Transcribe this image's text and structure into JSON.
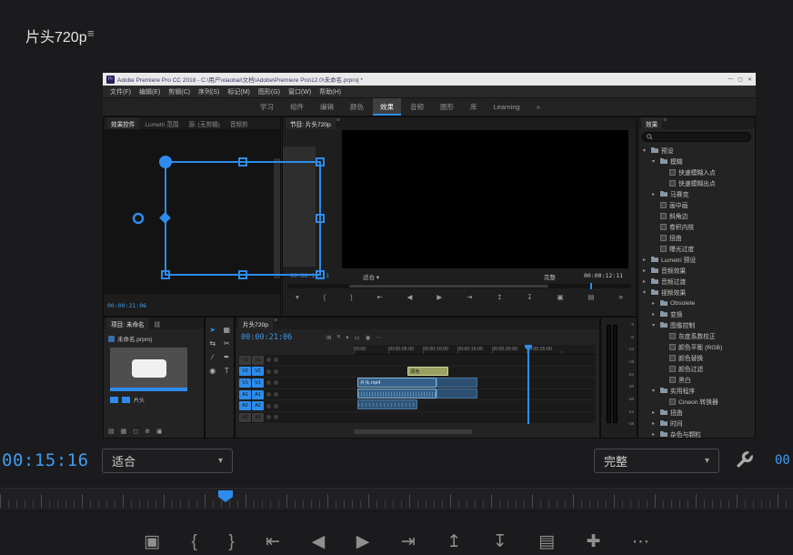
{
  "monitor": {
    "title": "片头720p",
    "panel_menu": "≡",
    "timecode": "00:15:16",
    "fit": "适合",
    "quality": "完整",
    "duration_partial": "00",
    "transport_icons": [
      "▣",
      "{",
      "}",
      "⇤",
      "◀",
      "▶",
      "⇥",
      "↥",
      "↧",
      "▤",
      "✚",
      "⋯"
    ]
  },
  "premiere": {
    "window_title": "Adobe Premiere Pro CC 2018 - C:\\用户\\xiaobai\\文档\\Adobe\\Premiere Pro\\12.0\\未命名.prproj *",
    "logo": "Pr",
    "window_buttons": [
      "—",
      "▢",
      "✕"
    ],
    "menus": [
      "文件(F)",
      "编辑(E)",
      "剪辑(C)",
      "序列(S)",
      "标记(M)",
      "图形(G)",
      "窗口(W)",
      "帮助(H)"
    ],
    "workspaces": [
      {
        "label": "学习"
      },
      {
        "label": "组件"
      },
      {
        "label": "编辑"
      },
      {
        "label": "颜色"
      },
      {
        "label": "效果",
        "cls": "active"
      },
      {
        "label": "音频"
      },
      {
        "label": "图形"
      },
      {
        "label": "库"
      },
      {
        "label": "Learning"
      },
      {
        "label": "»"
      }
    ],
    "effect_controls": {
      "tabs": [
        {
          "label": "效果控件",
          "cls": "active"
        },
        {
          "label": "Lumetri 范围"
        },
        {
          "label": "源: (无剪辑)"
        },
        {
          "label": "音频剪"
        }
      ],
      "timecode": "00:00:21:06"
    },
    "program": {
      "tab": "节目: 片头720p",
      "timecode": "00:00:12:11",
      "fit": "适合 ▾",
      "quality": "完整",
      "duration": "00:00:12:11",
      "transport_icons": [
        "▾",
        "{",
        "}",
        "⇤",
        "◀",
        "▶",
        "⇥",
        "↥",
        "↧",
        "▣",
        "▤",
        "≡"
      ]
    },
    "project": {
      "tabs": [
        {
          "label": "项目: 未命名",
          "cls": "active"
        },
        {
          "label": "媒"
        }
      ],
      "file": "未命名.prproj",
      "item_label": "片头",
      "footer_icons": [
        "▤",
        "▦",
        "◻",
        "⊕",
        "▣"
      ]
    },
    "tools": [
      {
        "g": "➤",
        "cls": "active"
      },
      {
        "g": "▦"
      },
      {
        "g": "⇆"
      },
      {
        "g": "✂"
      },
      {
        "g": "∕"
      },
      {
        "g": "✒"
      },
      {
        "g": "◉"
      },
      {
        "g": "T"
      }
    ],
    "timeline": {
      "tab": "片头720p",
      "timecode": "00:00:21:06",
      "toolbar_icons": [
        "⊞",
        "≡",
        "▾",
        "▭",
        "◉",
        "⋯"
      ],
      "ruler": [
        "00:00",
        "00:00:05:00",
        "00:00:10:00",
        "00:00:15:00",
        "00:00:20:00",
        "00:00:25:00"
      ],
      "tracks": [
        {
          "name": "V3",
          "cls": "dim"
        },
        {
          "name": "V2",
          "cls": "blue"
        },
        {
          "name": "V1",
          "cls": "blue"
        },
        {
          "name": "A1",
          "cls": "blue"
        },
        {
          "name": "A2",
          "cls": "blue"
        },
        {
          "name": "A3",
          "cls": "dim"
        }
      ],
      "clips": {
        "graphic": "调色",
        "video": "片头.mp4"
      }
    },
    "meters": [
      "0",
      "-6",
      "-12",
      "-18",
      "-24",
      "-30",
      "-36",
      "-42",
      "-48"
    ],
    "effects_panel": {
      "tab": "效果",
      "tree": [
        {
          "arrow": "▾",
          "label": "预设",
          "cls": "l0"
        },
        {
          "arrow": "▾",
          "label": "模糊",
          "cls": "l1"
        },
        {
          "arrow": "",
          "label": "快速模糊入点",
          "cls": "l2 fx"
        },
        {
          "arrow": "",
          "label": "快速模糊出点",
          "cls": "l2 fx"
        },
        {
          "arrow": "▸",
          "label": "马赛克",
          "cls": "l1"
        },
        {
          "arrow": "",
          "label": "画中画",
          "cls": "l1 fx"
        },
        {
          "arrow": "",
          "label": "斜角边",
          "cls": "l1 fx"
        },
        {
          "arrow": "",
          "label": "卷积内核",
          "cls": "l1 fx"
        },
        {
          "arrow": "",
          "label": "扭曲",
          "cls": "l1 fx"
        },
        {
          "arrow": "",
          "label": "曝光过度",
          "cls": "l1 fx"
        },
        {
          "arrow": "▸",
          "label": "Lumetri 预设",
          "cls": "l0"
        },
        {
          "arrow": "▸",
          "label": "音频效果",
          "cls": "l0"
        },
        {
          "arrow": "▸",
          "label": "音频过渡",
          "cls": "l0"
        },
        {
          "arrow": "▾",
          "label": "视频效果",
          "cls": "l0"
        },
        {
          "arrow": "▸",
          "label": "Obsolete",
          "cls": "l1"
        },
        {
          "arrow": "▸",
          "label": "变换",
          "cls": "l1"
        },
        {
          "arrow": "▾",
          "label": "图像控制",
          "cls": "l1"
        },
        {
          "arrow": "",
          "label": "灰度系数校正",
          "cls": "l2 fx"
        },
        {
          "arrow": "",
          "label": "颜色平衡 (RGB)",
          "cls": "l2 fx"
        },
        {
          "arrow": "",
          "label": "颜色替换",
          "cls": "l2 fx"
        },
        {
          "arrow": "",
          "label": "颜色过滤",
          "cls": "l2 fx"
        },
        {
          "arrow": "",
          "label": "黑白",
          "cls": "l2 fx"
        },
        {
          "arrow": "▾",
          "label": "实用程序",
          "cls": "l1"
        },
        {
          "arrow": "",
          "label": "Cineon 转换器",
          "cls": "l2 fx"
        },
        {
          "arrow": "▸",
          "label": "扭曲",
          "cls": "l1"
        },
        {
          "arrow": "▸",
          "label": "时间",
          "cls": "l1"
        },
        {
          "arrow": "▸",
          "label": "杂色与颗粒",
          "cls": "l1"
        }
      ]
    }
  }
}
